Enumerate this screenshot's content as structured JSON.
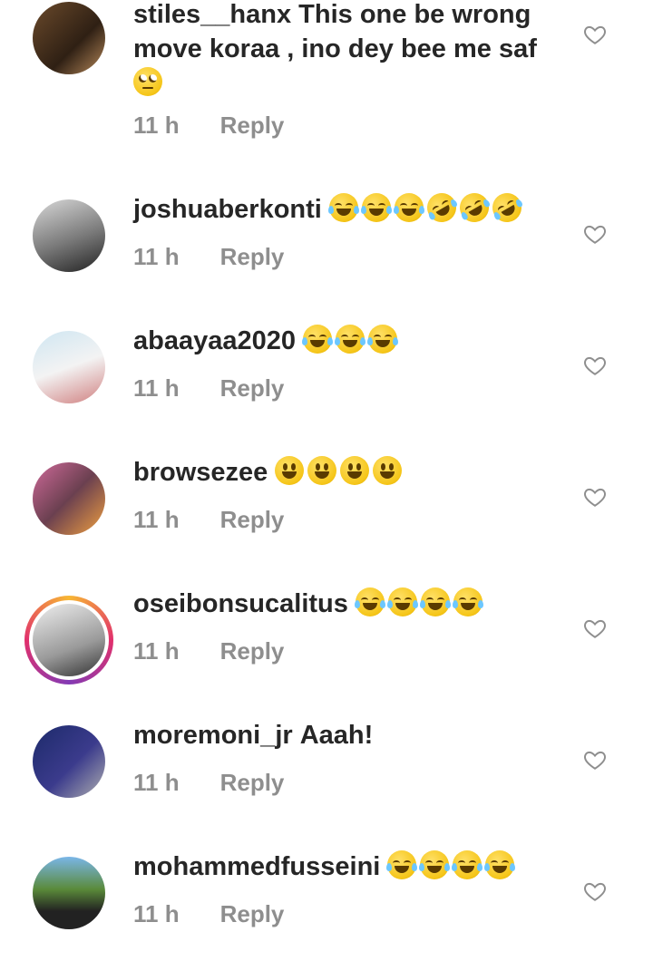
{
  "comments": [
    {
      "username": "stiles__hanx",
      "text": "This one be wrong move koraa , ino dey bee me saf",
      "emojis": [
        "roll"
      ],
      "time": "11 h",
      "reply": "Reply",
      "avatar": "avatar-photo",
      "story": false
    },
    {
      "username": "joshuaberkonti",
      "text": "",
      "emojis": [
        "joy",
        "joy",
        "joy",
        "rofl",
        "rofl",
        "rofl"
      ],
      "time": "11 h",
      "reply": "Reply",
      "avatar": "avatar-photo",
      "story": false
    },
    {
      "username": "abaayaa2020",
      "text": "",
      "emojis": [
        "joy",
        "joy",
        "joy"
      ],
      "time": "11 h",
      "reply": "Reply",
      "avatar": "avatar-photo",
      "story": false
    },
    {
      "username": "browsezee",
      "text": "",
      "emojis": [
        "grin",
        "grin",
        "grin",
        "grin"
      ],
      "time": "11 h",
      "reply": "Reply",
      "avatar": "avatar-photo",
      "story": false
    },
    {
      "username": "oseibonsucalitus",
      "text": "",
      "emojis": [
        "joy",
        "joy",
        "joy",
        "joy"
      ],
      "time": "11 h",
      "reply": "Reply",
      "avatar": "avatar-photo",
      "story": true
    },
    {
      "username": "moremoni_jr",
      "text": "Aaah!",
      "emojis": [],
      "time": "11 h",
      "reply": "Reply",
      "avatar": "avatar-photo",
      "story": false
    },
    {
      "username": "mohammedfusseini",
      "text": "",
      "emojis": [
        "joy",
        "joy",
        "joy",
        "joy"
      ],
      "time": "11 h",
      "reply": "Reply",
      "avatar": "avatar-photo",
      "story": false
    }
  ],
  "icons": {
    "like": "heart-outline-icon"
  },
  "colors": {
    "text": "#262626",
    "meta": "#8e8e8e",
    "story_ring": "#e1306c"
  }
}
